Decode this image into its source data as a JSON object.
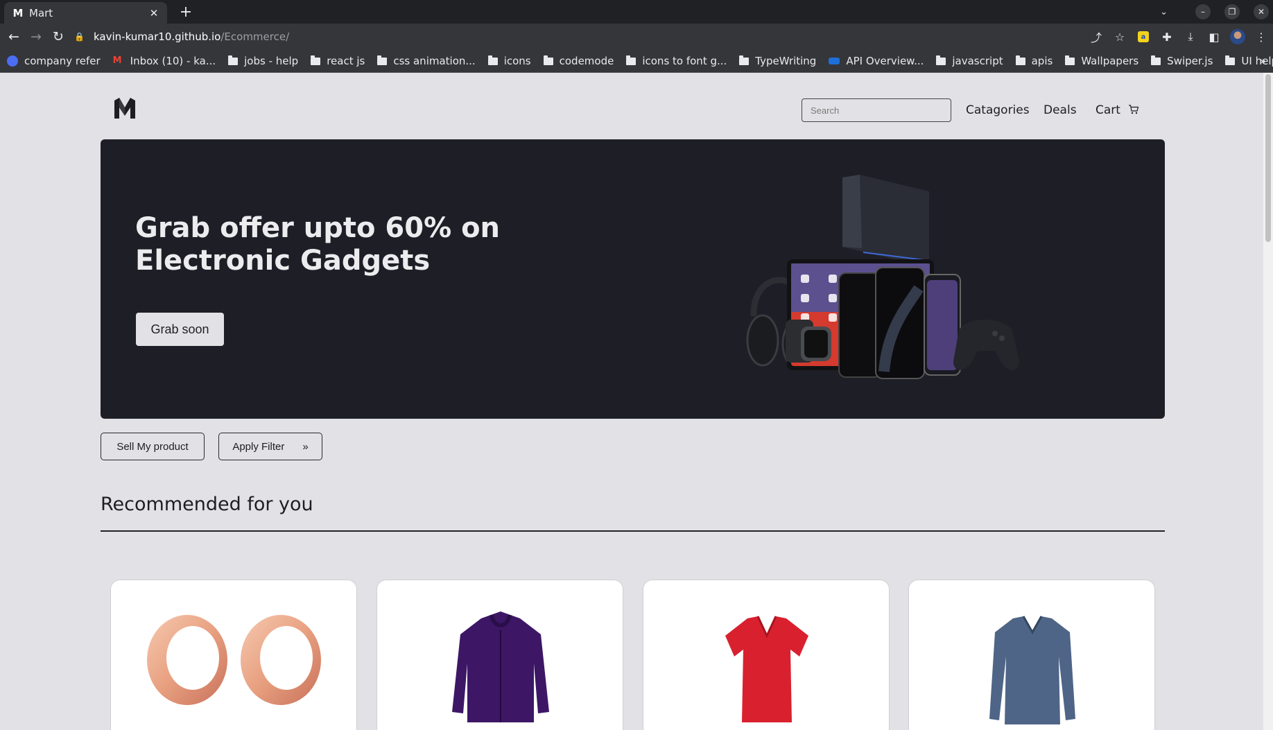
{
  "browser": {
    "tab_title": "Mart",
    "tab_close": "✕",
    "new_tab": "+",
    "url_host": "kavin-kumar10.github.io",
    "url_path": "/Ecommerce/",
    "bookmarks": [
      {
        "label": "company refer",
        "icon": "round-icon"
      },
      {
        "label": "Inbox (10) - ka...",
        "icon": "gmail-icon"
      },
      {
        "label": "jobs - help",
        "icon": "folder-icon"
      },
      {
        "label": "react js",
        "icon": "folder-icon"
      },
      {
        "label": "css animation...",
        "icon": "folder-icon"
      },
      {
        "label": "icons",
        "icon": "folder-icon"
      },
      {
        "label": "codemode",
        "icon": "folder-icon"
      },
      {
        "label": "icons to font g...",
        "icon": "folder-icon"
      },
      {
        "label": "TypeWriting",
        "icon": "folder-icon"
      },
      {
        "label": "API Overview...",
        "icon": "api-icon"
      },
      {
        "label": "javascript",
        "icon": "folder-icon"
      },
      {
        "label": "apis",
        "icon": "folder-icon"
      },
      {
        "label": "Wallpapers",
        "icon": "folder-icon"
      },
      {
        "label": "Swiper.js",
        "icon": "folder-icon"
      },
      {
        "label": "UI help",
        "icon": "folder-icon"
      }
    ],
    "bookmarks_more": "»"
  },
  "header": {
    "search_placeholder": "Search",
    "nav": {
      "categories": "Catagories",
      "deals": "Deals",
      "cart": "Cart"
    }
  },
  "hero": {
    "title": "Grab offer upto 60% on Electronic Gadgets",
    "button": "Grab soon"
  },
  "actions": {
    "sell": "Sell My product",
    "filter": "Apply Filter",
    "filter_icon": "»"
  },
  "recommended": {
    "title": "Recommended for you",
    "products": [
      {
        "name": "rose-gold-ear-tunnels",
        "color": "#e8a080"
      },
      {
        "name": "purple-jacket",
        "color": "#3d1766"
      },
      {
        "name": "red-v-neck-tshirt",
        "color": "#d9202e"
      },
      {
        "name": "blue-long-sleeve-shirt",
        "color": "#4f6587"
      }
    ]
  },
  "colors": {
    "page_bg": "#e2e2e6",
    "hero_bg": "#1e1e26",
    "text_dark": "#1d1d22"
  }
}
